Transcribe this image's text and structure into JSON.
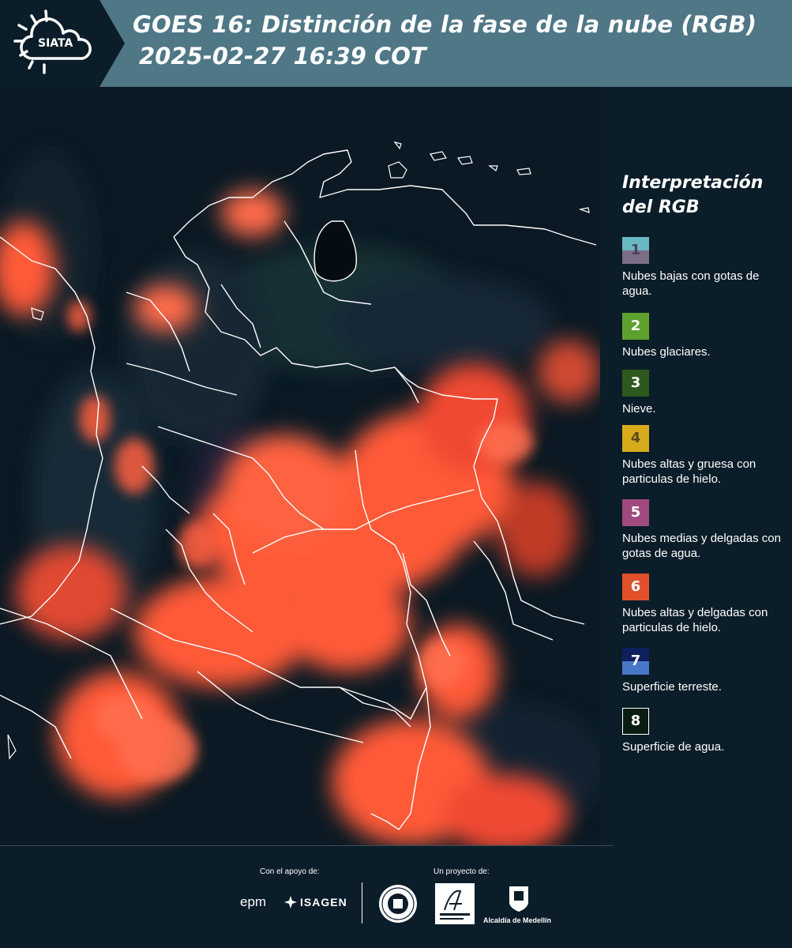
{
  "header": {
    "logo_text": "SIATA",
    "title_line1": "GOES 16: Distinción de la fase de la nube (RGB)",
    "title_line2": "2025-02-27 16:39 COT"
  },
  "map": {
    "icon": "satellite-rgb-map"
  },
  "legend": {
    "title": "Interpretación del RGB",
    "items": [
      {
        "number": "1",
        "label": "Nubes bajas con gotas de agua.",
        "color_top": "#6ab8c4",
        "color_bottom": "#7b6e86",
        "text_color": "#5a4f60"
      },
      {
        "number": "2",
        "label": "Nubes glaciares.",
        "color": "#5fa12e",
        "text_color": "#ffffff"
      },
      {
        "number": "3",
        "label": "Nieve.",
        "color": "#2d5a1c",
        "text_color": "#ffffff"
      },
      {
        "number": "4",
        "label": "Nubes altas y gruesa con particulas de hielo.",
        "color": "#d8ab1a",
        "text_color": "#5a4a1a"
      },
      {
        "number": "5",
        "label": "Nubes medias y delgadas con gotas de agua.",
        "color": "#a04a80",
        "text_color": "#ffffff"
      },
      {
        "number": "6",
        "label": "Nubes altas y delgadas con particulas de hielo.",
        "color": "#e0502a",
        "text_color": "#ffffff"
      },
      {
        "number": "7",
        "label": "Superficie terreste.",
        "color_top": "#0d1f5c",
        "color_bottom": "#4a78c8",
        "text_color": "#ffffff"
      },
      {
        "number": "8",
        "label": "Superficie de agua.",
        "color": "#0b1d10",
        "text_color": "#ffffff",
        "border": "#ffffff"
      }
    ]
  },
  "footer": {
    "support_label": "Con el apoyo de:",
    "project_label": "Un proyecto de:",
    "sponsor1": "epm",
    "sponsor2": "ISAGEN",
    "partner1": "Área Metropolitana",
    "partner2": "Alcaldía de Medellín"
  }
}
